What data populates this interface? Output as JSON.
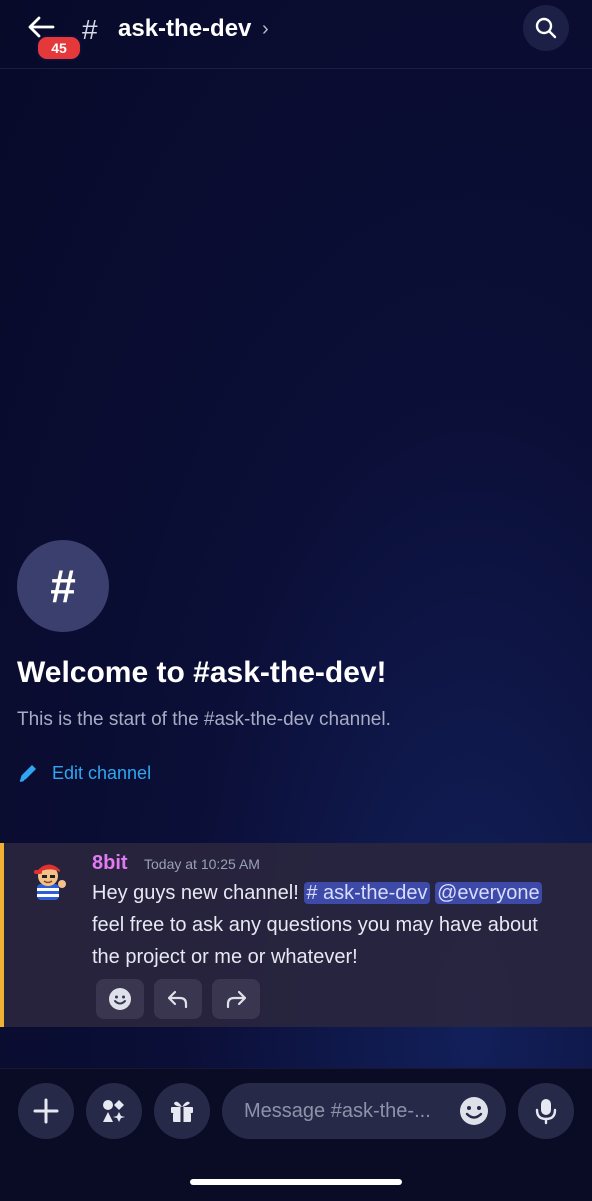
{
  "header": {
    "unread_count": "45",
    "channel_hash": "#",
    "channel_name": "ask-the-dev",
    "chevron": "›",
    "back_icon": "arrow-left-icon",
    "search_icon": "search-icon"
  },
  "welcome": {
    "icon_glyph": "#",
    "title": "Welcome to #ask-the-dev!",
    "subtitle": "This is the start of the #ask-the-dev channel.",
    "edit_label": "Edit channel"
  },
  "message": {
    "author": "8bit",
    "timestamp": "Today at 10:25 AM",
    "text_intro": "Hey guys new channel! ",
    "channel_mention": "# ask-the-dev",
    "user_mention": "@everyone",
    "text_rest": " feel free to ask any questions you may have about the project or me or whatever!",
    "actions": [
      "add-reaction-icon",
      "reply-icon",
      "forward-icon"
    ]
  },
  "composer": {
    "placeholder": "Message #ask-the-...",
    "buttons": [
      "plus-icon",
      "apps-icon",
      "gift-icon",
      "emoji-icon",
      "microphone-icon"
    ]
  },
  "colors": {
    "accent_link": "#2fa6f3",
    "author": "#e27af2",
    "badge": "#e5383b",
    "highlight_bar": "#f0b232",
    "mention_bg": "#3e4aa8"
  }
}
